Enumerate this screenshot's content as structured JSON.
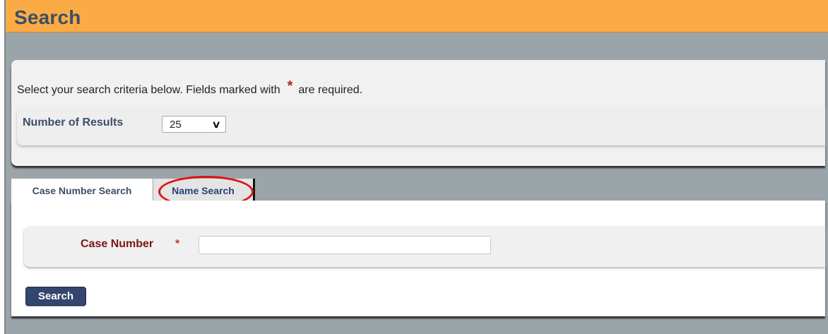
{
  "page": {
    "title": "Search"
  },
  "criteria": {
    "intro_before": "Select your search criteria below. Fields marked with",
    "required_marker": "*",
    "intro_after": "are required.",
    "results_label": "Number of Results",
    "results_value": "25"
  },
  "tabs": [
    {
      "label": "Case Number Search",
      "active": true
    },
    {
      "label": "Name Search",
      "active": false,
      "highlighted": true
    }
  ],
  "form": {
    "case_number_label": "Case Number",
    "required_marker": "*",
    "case_number_value": "",
    "search_button": "Search"
  },
  "colors": {
    "title_bar": "#fbab45",
    "background": "#9aa4a9",
    "highlight_ring": "#e01010",
    "button": "#34466e"
  },
  "icons": {
    "dropdown": "chevron-down-icon"
  }
}
